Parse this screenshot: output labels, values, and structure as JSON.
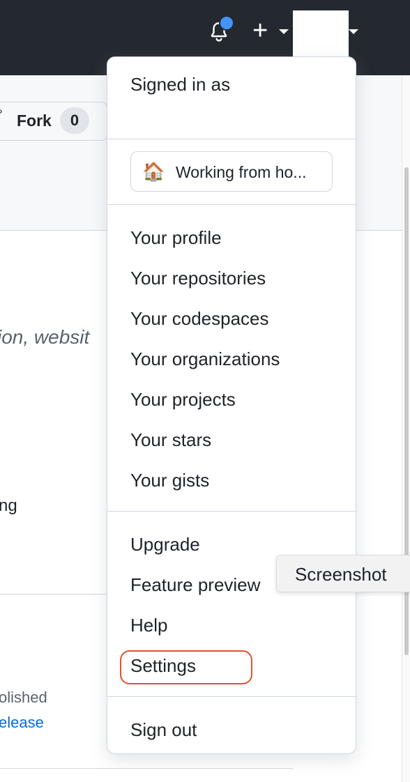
{
  "header": {
    "notification_icon": "bell-icon",
    "notification_dot_color": "#4493f8",
    "create_label": "+",
    "create_caret_icon": "caret-down-icon",
    "avatar_caret_icon": "caret-down-icon"
  },
  "repo": {
    "fork_label": "Fork",
    "fork_count": "0",
    "description_fragment": "ion, websit",
    "about_fragment": "ng",
    "release_published_fragment": "olished",
    "release_link_fragment": "elease"
  },
  "menu": {
    "signed_in_label": "Signed in as",
    "status": {
      "emoji": "🏠",
      "text": "Working from ho..."
    },
    "section_profile": [
      {
        "label": "Your profile"
      },
      {
        "label": "Your repositories"
      },
      {
        "label": "Your codespaces"
      },
      {
        "label": "Your organizations"
      },
      {
        "label": "Your projects"
      },
      {
        "label": "Your stars"
      },
      {
        "label": "Your gists"
      }
    ],
    "section_misc": [
      {
        "label": "Upgrade"
      },
      {
        "label": "Feature preview"
      },
      {
        "label": "Help"
      },
      {
        "label": "Settings"
      }
    ],
    "sign_out_label": "Sign out",
    "highlight_color": "#e2522f"
  },
  "tooltip": {
    "text": "Screenshot"
  },
  "colors": {
    "header_bg": "#24292f",
    "link_blue": "#0969da",
    "border": "#d0d7de"
  }
}
